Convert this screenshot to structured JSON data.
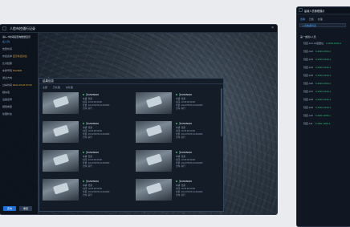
{
  "main": {
    "title": "人脸布控通行记录",
    "filter_title": "请1~7时间段查询数量显示",
    "tab_label": "名人列",
    "left_rows": [
      {
        "k": "告警时间",
        "v": ""
      },
      {
        "k": "布控名单",
        "v": "显示条目对比"
      },
      {
        "k": "比对结果",
        "v": ""
      },
      {
        "k": "车牌号码",
        "v": "PH30R5"
      },
      {
        "k": "通过方向",
        "v": ""
      },
      {
        "k": "过车时间",
        "v": "2021-05-18 07:00"
      },
      {
        "k": "相似度",
        "v": ""
      },
      {
        "k": "设备名称",
        "v": ""
      },
      {
        "k": "报警类型",
        "v": ""
      },
      {
        "k": "处理状态",
        "v": ""
      }
    ],
    "btn_query": "查询",
    "btn_reset": "重置",
    "dialog": {
      "title": "结果信息",
      "tabs": [
        "全部",
        "已处理",
        "未处理"
      ],
      "cards": [
        {
          "plate": "沪A5R5R00",
          "l1": "车辆: 普通",
          "l2": "时间: 10:15:00 00:00",
          "l3": "位置: 101.270970,31.601000",
          "l4": "方向: 南行"
        },
        {
          "plate": "沪A5R5R00",
          "l1": "车辆: 普通",
          "l2": "时间: 10:15:00 00:00",
          "l3": "位置: 101.270970,31.601000",
          "l4": "方向: 南行"
        },
        {
          "plate": "沪A5R5R00",
          "l1": "车辆: 普通",
          "l2": "时间: 10:15:00 00:00",
          "l3": "位置: 101.270970,31.601000",
          "l4": "方向: 南行"
        },
        {
          "plate": "沪A5R5R00",
          "l1": "车辆: 普通",
          "l2": "时间: 10:15:00 00:00",
          "l3": "位置: 101.270970,31.601000",
          "l4": "方向: 南行"
        },
        {
          "plate": "沪A5R5R00",
          "l1": "车辆: 普通",
          "l2": "时间: 10:15:00 00:00",
          "l3": "位置: 101.270970,31.601000",
          "l4": "方向: 南行"
        },
        {
          "plate": "沪A5R5R00",
          "l1": "车辆: 普通",
          "l2": "时间: 10:15:00 00:00",
          "l3": "位置: 101.270970,31.601000",
          "l4": "方向: 南行"
        },
        {
          "plate": "沪A5R5R00",
          "l1": "车辆: 普通",
          "l2": "时间: 10:15:00 00:00",
          "l3": "位置: 101.270970,31.601000",
          "l4": "方向: 南行"
        },
        {
          "plate": "沪A5R5R00",
          "l1": "车辆: 普通",
          "l2": "时间: 10:15:00 00:00",
          "l3": "位置: 101.270970,31.601000",
          "l4": "方向: 南行"
        }
      ]
    }
  },
  "side": {
    "title": "星城人员管理展示",
    "toolbar": [
      "查看",
      "已核",
      "处理"
    ],
    "search_label": "人员数据列表",
    "group": "第一类别1人员",
    "items": [
      {
        "name": "辖区-101 01层居住",
        "tag": "0-2DR-1000-1"
      },
      {
        "name": "辖区-102",
        "tag": "0-2DR-1000-1"
      },
      {
        "name": "辖区-103",
        "tag": "0-2DR-1000-1"
      },
      {
        "name": "辖区-104",
        "tag": "0-2DR-1000-1"
      },
      {
        "name": "辖区-105",
        "tag": "0-2DR-1000-1"
      },
      {
        "name": "辖区-106",
        "tag": "0-2DR-1000-1"
      },
      {
        "name": "辖区-107",
        "tag": "0-2DR-1000-1"
      },
      {
        "name": "辖区-108",
        "tag": "0-2DR-1000-1"
      },
      {
        "name": "辖区-109",
        "tag": "0-2DR-1000-1"
      },
      {
        "name": "辖区-110",
        "tag": "0-2DR-1000-1"
      },
      {
        "name": "辖区-111",
        "tag": "0-2DR-1000-1"
      }
    ]
  },
  "colors": {
    "accent": "#1e6fd9",
    "ok": "#2fbf71",
    "bg": "#101722"
  }
}
